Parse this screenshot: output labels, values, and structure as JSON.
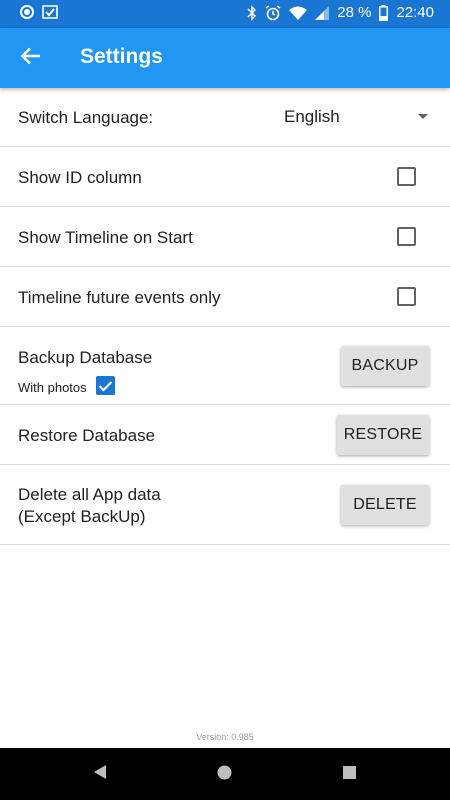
{
  "status_bar": {
    "battery_text": "28 %",
    "time": "22:40",
    "icons": [
      "circle-app-icon",
      "mail-check-icon",
      "bluetooth-icon",
      "alarm-icon",
      "wifi-icon",
      "signal-icon",
      "battery-icon"
    ]
  },
  "app_bar": {
    "title": "Settings",
    "back_icon": "arrow-back-icon"
  },
  "settings": {
    "language": {
      "label": "Switch Language:",
      "value": "English"
    },
    "show_id_column": {
      "label": "Show ID column",
      "checked": false
    },
    "show_timeline": {
      "label": "Show Timeline on Start",
      "checked": false
    },
    "timeline_future": {
      "label": "Timeline future events only",
      "checked": false
    },
    "backup": {
      "label": "Backup Database",
      "sub_label": "With photos",
      "with_photos_checked": true,
      "button": "BACKUP"
    },
    "restore": {
      "label": "Restore Database",
      "button": "RESTORE"
    },
    "delete": {
      "label_line1": "Delete all App data",
      "label_line2": "(Except BackUp)",
      "button": "DELETE"
    }
  },
  "footer": {
    "version": "Version: 0.985"
  },
  "colors": {
    "status_bar": "#1976d2",
    "app_bar": "#2196f3",
    "checkbox_checked": "#1976d2",
    "button_bg": "#e0e0e0"
  }
}
